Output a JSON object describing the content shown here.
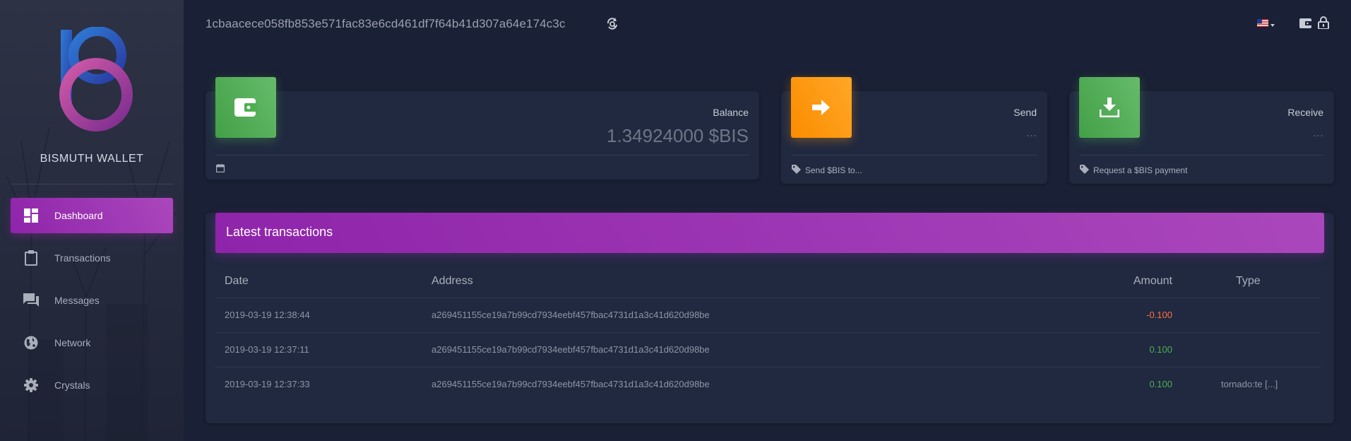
{
  "sidebar": {
    "title": "BISMUTH WALLET",
    "items": [
      {
        "label": "Dashboard",
        "icon": "dashboard-icon",
        "active": true
      },
      {
        "label": "Transactions",
        "icon": "clipboard-icon",
        "active": false
      },
      {
        "label": "Messages",
        "icon": "chat-icon",
        "active": false
      },
      {
        "label": "Network",
        "icon": "globe-icon",
        "active": false
      },
      {
        "label": "Crystals",
        "icon": "gear-icon",
        "active": false
      }
    ]
  },
  "header": {
    "address": "1cbaacece058fb853e571fac83e6cd461df7f64b41d307a64e174c3c",
    "refresh_icon": "refresh-search-icon",
    "flag_icon": "us-flag-icon",
    "wallet_icon": "wallet-icon",
    "lock_icon": "lock-icon"
  },
  "cards": {
    "balance": {
      "category": "Balance",
      "value": "1.34924000 $BIS",
      "footer_icon": "calendar-icon"
    },
    "send": {
      "category": "Send",
      "value": "...",
      "footer": "Send $BIS to..."
    },
    "receive": {
      "category": "Receive",
      "value": "...",
      "footer": "Request a $BIS payment"
    }
  },
  "transactions": {
    "title": "Latest transactions",
    "columns": [
      "Date",
      "Address",
      "Amount",
      "Type"
    ],
    "rows": [
      {
        "date": "2019-03-19 12:38:44",
        "address": "a269451155ce19a7b99cd7934eebf457fbac4731d1a3c41d620d98be",
        "amount": "-0.100",
        "type": ""
      },
      {
        "date": "2019-03-19 12:37:11",
        "address": "a269451155ce19a7b99cd7934eebf457fbac4731d1a3c41d620d98be",
        "amount": "0.100",
        "type": ""
      },
      {
        "date": "2019-03-19 12:37:33",
        "address": "a269451155ce19a7b99cd7934eebf457fbac4731d1a3c41d620d98be",
        "amount": "0.100",
        "type": "tornado:te [...]"
      }
    ]
  },
  "colors": {
    "accent_purple": "#9c27b0",
    "green": "#4caf50",
    "orange": "#ff9800",
    "negative": "#ff7043",
    "background": "#1a2035"
  }
}
